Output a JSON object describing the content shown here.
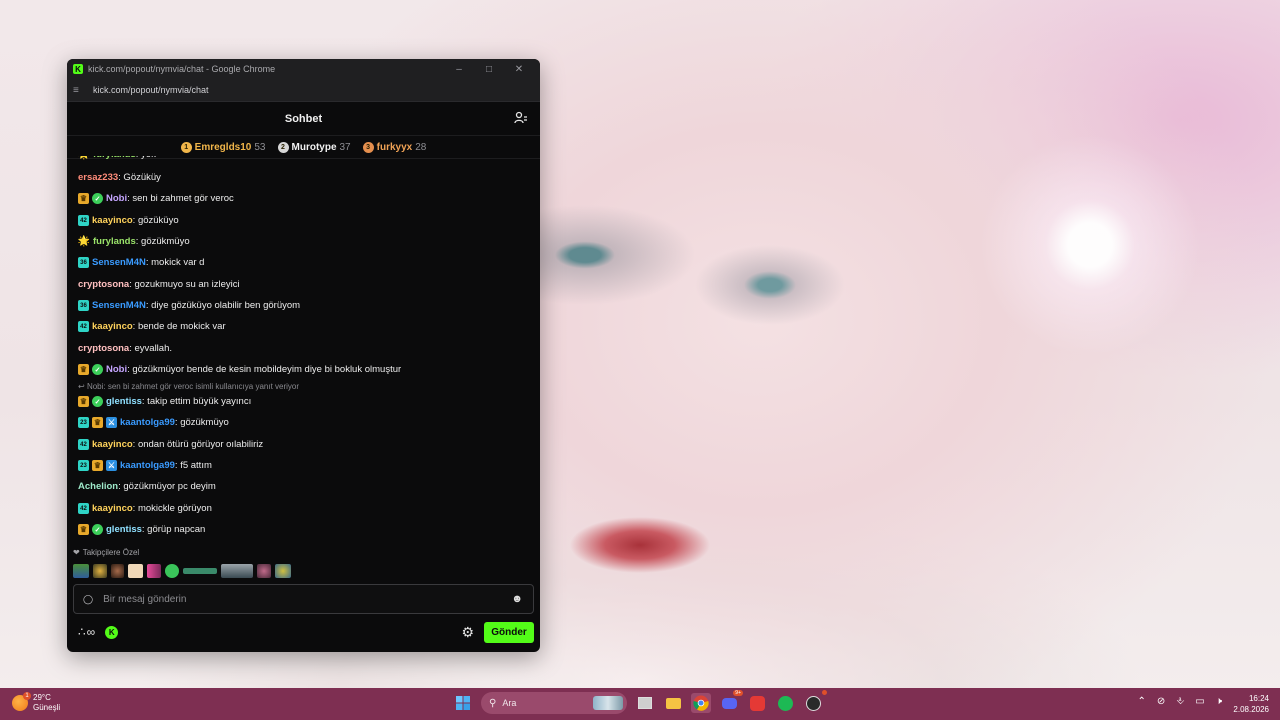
{
  "window": {
    "title": "kick.com/popout/nymvia/chat - Google Chrome",
    "url": "kick.com/popout/nymvia/chat",
    "favicon": "K"
  },
  "chat": {
    "header_title": "Sohbet",
    "leaderboard": [
      {
        "rank": "1",
        "name": "Emreglds10",
        "score": "53",
        "color": "#f1b64a",
        "rank_color": "#f1b64a"
      },
      {
        "rank": "2",
        "name": "Murotype",
        "score": "37",
        "color": "#f2f2f2",
        "rank_color": "#d7d7d7"
      },
      {
        "rank": "3",
        "name": "furkyyx",
        "score": "28",
        "color": "#f1a356",
        "rank_color": "#e58f4e"
      }
    ],
    "messages": [
      {
        "user": "furylands",
        "text": ": yok",
        "color": "#9ae36a",
        "badges": [
          "emoji"
        ]
      },
      {
        "user": "ersaz233",
        "text": ": Gözüküy",
        "color": "#ff8c7a",
        "badges": []
      },
      {
        "user": "Nobi",
        "text": ": sen bi zahmet gör veroc",
        "color": "#c5a5ff",
        "badges": [
          "crown",
          "verified"
        ]
      },
      {
        "user": "kaayinco",
        "text": ": gözüküyo",
        "color": "#ffd35c",
        "badges": [
          "sub42"
        ]
      },
      {
        "user": "furylands",
        "text": ": gözükmüyo",
        "color": "#9ae36a",
        "badges": [
          "emoji"
        ]
      },
      {
        "user": "SensenM4N",
        "text": ": mokick var d",
        "color": "#3a9bff",
        "badges": [
          "sub36"
        ]
      },
      {
        "user": "cryptosona",
        "text": ": gozukmuyo su an izleyici",
        "color": "#ffc0c0",
        "badges": []
      },
      {
        "user": "SensenM4N",
        "text": ": diye gözüküyo olabilir ben görüyom",
        "color": "#3a9bff",
        "badges": [
          "sub36"
        ]
      },
      {
        "user": "kaayinco",
        "text": ": bende de mokick var",
        "color": "#ffd35c",
        "badges": [
          "sub42"
        ]
      },
      {
        "user": "cryptosona",
        "text": ": eyvallah.",
        "color": "#ffc0c0",
        "badges": []
      },
      {
        "user": "Nobi",
        "text": ": gözükmüyor bende de kesin mobildeyim diye bi bokluk olmuştur",
        "color": "#c5a5ff",
        "badges": [
          "crown",
          "verified"
        ]
      },
      {
        "user": "glentiss",
        "text": ": takip ettim büyük yayıncı",
        "color": "#8fe0ff",
        "badges": [
          "crown",
          "verified"
        ]
      },
      {
        "user": "kaantolga99",
        "text": ": gözükmüyo",
        "color": "#3a9bff",
        "badges": [
          "sub23",
          "crown",
          "sword"
        ]
      },
      {
        "user": "kaayinco",
        "text": ": ondan ötürü görüyor oılabiliriz",
        "color": "#ffd35c",
        "badges": [
          "sub42"
        ]
      },
      {
        "user": "kaantolga99",
        "text": ": f5 attım",
        "color": "#3a9bff",
        "badges": [
          "sub23",
          "crown",
          "sword"
        ]
      },
      {
        "user": "Achelion",
        "text": ": gözükmüyor pc deyim",
        "color": "#9ee8c9",
        "badges": []
      },
      {
        "user": "kaayinco",
        "text": ": mokickle görüyon",
        "color": "#ffd35c",
        "badges": [
          "sub42"
        ]
      },
      {
        "user": "glentiss",
        "text": ": görüp napcan",
        "color": "#8fe0ff",
        "badges": [
          "crown",
          "verified"
        ]
      }
    ],
    "reply_note": "Nobi: sen bi zahmet gör veroc isimli kullanıcıya yanıt veriyor",
    "emote_section_label": "Takipçilere Özel",
    "input_placeholder": "Bir mesaj gönderin",
    "send_label": "Gönder",
    "infinity_symbol": "∞",
    "kick_badge": "K"
  },
  "taskbar": {
    "weather_temp": "29°C",
    "weather_desc": "Güneşli",
    "weather_badge": "1",
    "search_label": "Ara",
    "discord_badge": "9+",
    "time": "16:24",
    "date": "2.08.2026"
  }
}
